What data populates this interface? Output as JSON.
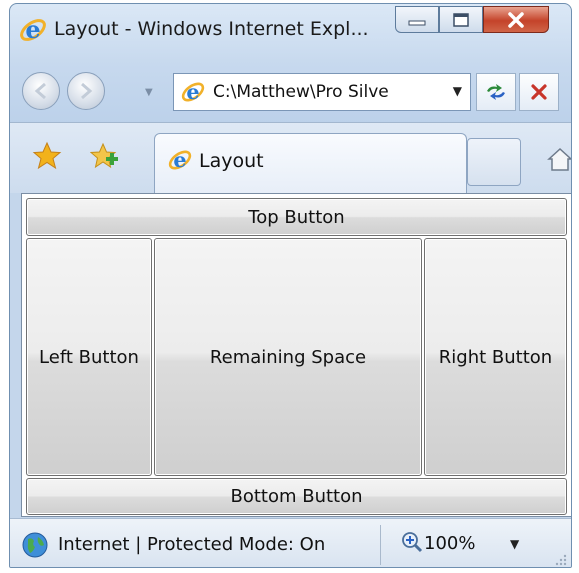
{
  "window": {
    "title": "Layout - Windows Internet Expl...",
    "caption_buttons": [
      "minimize",
      "maximize",
      "close"
    ]
  },
  "address_bar": {
    "url": "C:\\Matthew\\Pro Silve"
  },
  "tabs": [
    {
      "label": "Layout",
      "active": true
    }
  ],
  "content": {
    "top_button": "Top Button",
    "left_button": "Left Button",
    "center_button": "Remaining Space",
    "right_button": "Right Button",
    "bottom_button": "Bottom Button"
  },
  "status_bar": {
    "zone_text": "Internet | Protected Mode: On",
    "zoom_label": "100%"
  },
  "icons": {
    "ie": "ie-logo-icon",
    "favorites": "favorites-star-icon",
    "add_favorites": "add-favorites-icon",
    "home": "home-icon",
    "refresh": "refresh-icon",
    "stop": "stop-icon",
    "globe": "internet-globe-icon",
    "zoom": "zoom-icon"
  },
  "colors": {
    "close_button": "#c4432a",
    "frame": "#c7d9ee",
    "ie_blue": "#2a7bd4",
    "star_gold": "#f2b21b"
  }
}
